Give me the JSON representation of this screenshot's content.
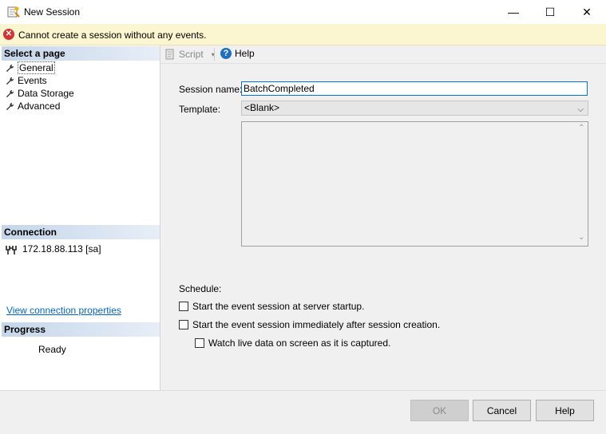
{
  "window": {
    "title": "New Session",
    "controls": {
      "minimize": "—",
      "maximize": "☐",
      "close": "✕"
    }
  },
  "error_bar": {
    "message": "Cannot create a session without any events."
  },
  "left_pane": {
    "select_page_header": "Select a page",
    "pages": [
      "General",
      "Events",
      "Data Storage",
      "Advanced"
    ],
    "connection_header": "Connection",
    "connection_server": "172.18.88.113 [sa]",
    "view_connection_link": "View connection properties",
    "progress_header": "Progress",
    "progress_status": "Ready"
  },
  "toolbar": {
    "script_label": "Script",
    "help_label": "Help"
  },
  "form": {
    "session_name_label": "Session name:",
    "session_name_value": "BatchCompleted",
    "template_label": "Template:",
    "template_value": "<Blank>",
    "schedule_label": "Schedule:",
    "options": [
      "Start the event session at server startup.",
      "Start the event session immediately after session creation.",
      "Watch live data on screen as it is captured."
    ]
  },
  "footer": {
    "ok_label": "OK",
    "cancel_label": "Cancel",
    "help_label": "Help"
  }
}
